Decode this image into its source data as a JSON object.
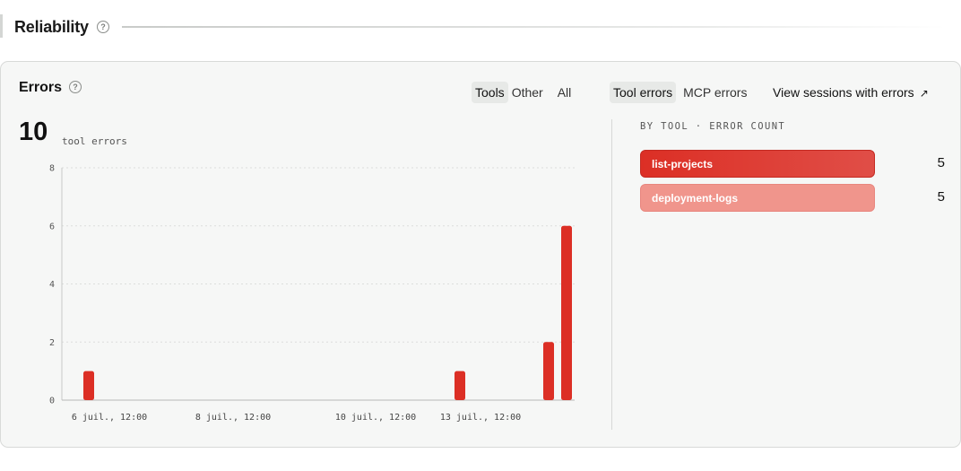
{
  "section": {
    "title": "Reliability",
    "help_glyph": "?"
  },
  "card": {
    "title": "Errors",
    "help_glyph": "?",
    "scope_tabs": [
      {
        "label": "Tools",
        "active": true
      },
      {
        "label": "Other",
        "active": false
      },
      {
        "label": "All",
        "active": false
      }
    ],
    "kind_tabs": [
      {
        "label": "Tool errors",
        "active": true
      },
      {
        "label": "MCP errors",
        "active": false
      }
    ],
    "view_link": {
      "label": "View sessions with errors",
      "icon": "arrow-up-right-icon",
      "glyph": "↗"
    },
    "total": "10",
    "total_label": "tool errors"
  },
  "chart_data": {
    "type": "bar",
    "ylim": [
      0,
      8
    ],
    "yticks": [
      "0",
      "2",
      "4",
      "6",
      "8"
    ],
    "xtick_labels": [
      "6 juil., 12:00",
      "8 juil., 12:00",
      "10 juil., 12:00",
      "13 juil., 12:00"
    ],
    "series": [
      {
        "values": [
          {
            "x": "6 juil., 12:00",
            "y": 1
          },
          {
            "x": "13 juil., 12:00",
            "y": 1
          },
          {
            "x": "14 juil.",
            "y": 2
          },
          {
            "x": "14 juil., 12:00",
            "y": 6
          }
        ]
      }
    ],
    "grid": true,
    "bar_color": "#dc2f25"
  },
  "breakdown": {
    "header": "BY TOOL · ERROR COUNT",
    "items": [
      {
        "name": "list-projects",
        "count": "5"
      },
      {
        "name": "deployment-logs",
        "count": "5"
      }
    ]
  }
}
